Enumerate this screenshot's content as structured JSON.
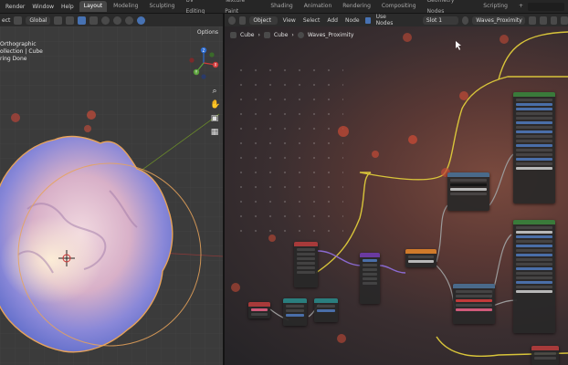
{
  "menu": {
    "render": "Render",
    "window": "Window",
    "help": "Help"
  },
  "workspace_tabs": [
    "Layout",
    "Modeling",
    "Sculpting",
    "UV Editing",
    "Texture Paint",
    "Shading",
    "Animation",
    "Rendering",
    "Compositing",
    "Geometry Nodes",
    "Scripting"
  ],
  "workspace_active": "Layout",
  "workspace_add": "+",
  "viewport": {
    "select_label": "ect",
    "orientation": "Global",
    "options": "Options",
    "info": {
      "line1": "Orthographic",
      "line2": "ollection | Cube",
      "line3": "ring Done"
    },
    "gizmo_axes": {
      "x": "X",
      "y": "Y",
      "z": "Z"
    }
  },
  "node_editor": {
    "object_mode": "Object",
    "menu": [
      "View",
      "Select",
      "Add",
      "Node"
    ],
    "use_nodes": "Use Nodes",
    "slot": "Slot 1",
    "material": "Waves_Proximity",
    "breadcrumb": [
      "Cube",
      "Cube",
      "Waves_Proximity"
    ]
  },
  "colors": {
    "accent": "#4772b3",
    "node_header_blue": "#3e6a9a",
    "node_header_red": "#a83a3a",
    "node_header_teal": "#2a7e7e",
    "node_header_purple": "#6a3aa0",
    "node_header_green": "#3a7a3a",
    "link_yellow": "#d8c43a",
    "link_purple": "#8a6ad0",
    "link_grey": "#9a9a9a"
  }
}
